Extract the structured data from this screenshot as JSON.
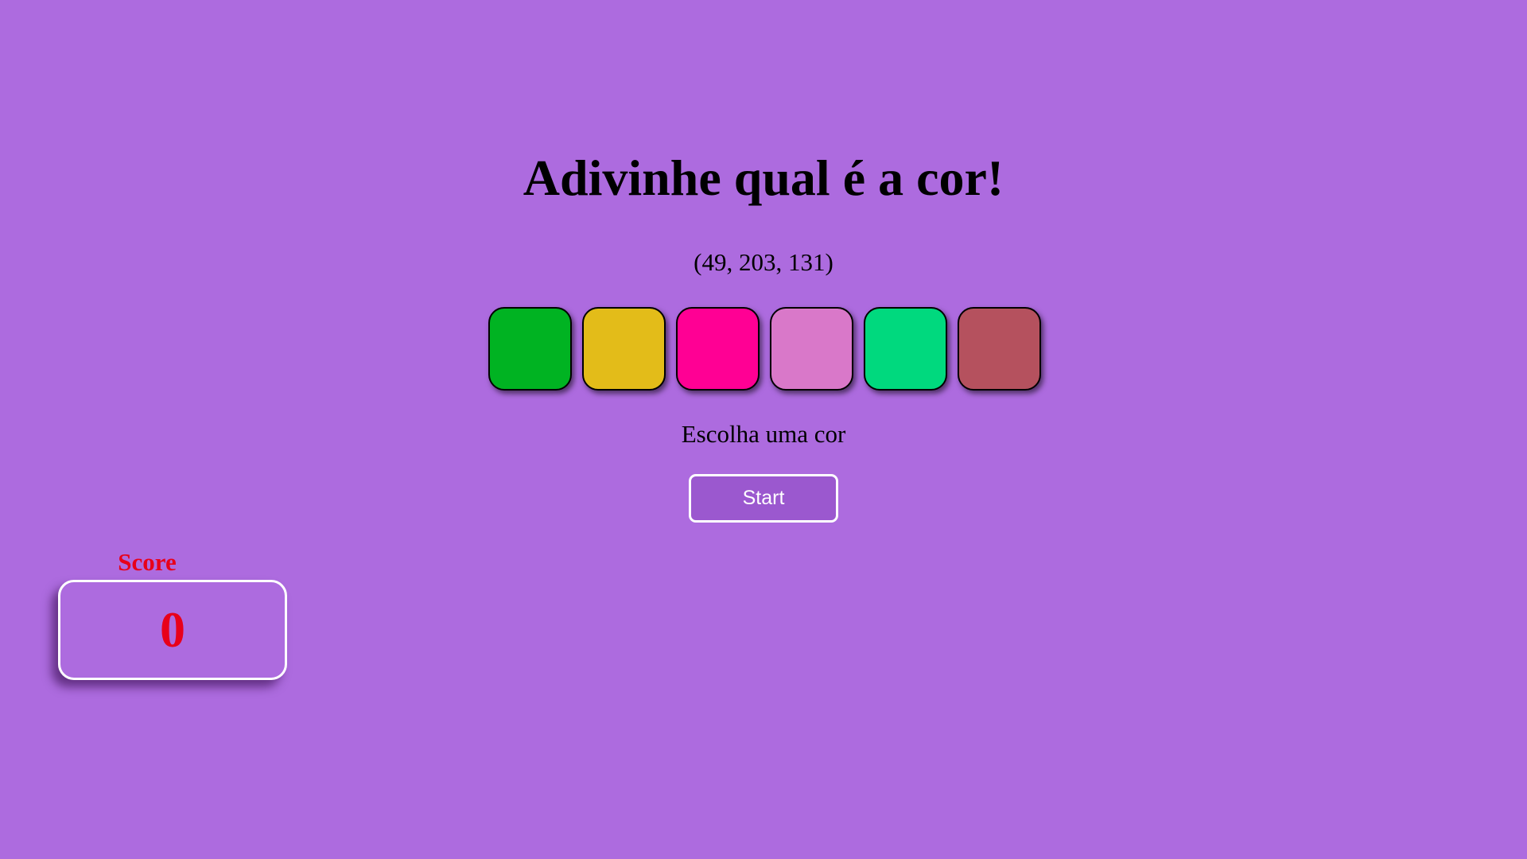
{
  "game": {
    "title": "Adivinhe qual é a cor!",
    "rgb_display": "(49, 203, 131)",
    "message": "Escolha uma cor",
    "start_label": "Start"
  },
  "swatches": [
    {
      "color": "#00b322"
    },
    {
      "color": "#e3bc19"
    },
    {
      "color": "#ff0094"
    },
    {
      "color": "#d978c9"
    },
    {
      "color": "#00d97e"
    },
    {
      "color": "#b5515e"
    }
  ],
  "score": {
    "label": "Score",
    "value": "0"
  },
  "colors": {
    "background": "#ad6bdf",
    "score_text": "#e8001a"
  }
}
